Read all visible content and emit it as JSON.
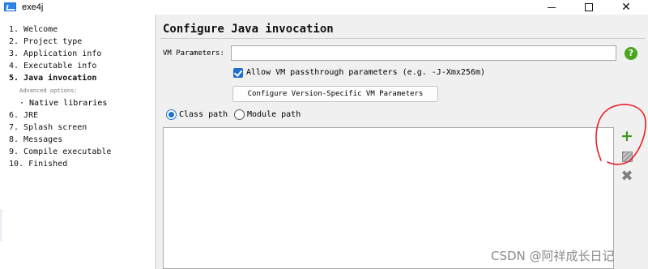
{
  "window": {
    "title": "exe4j"
  },
  "nav": {
    "items": [
      "1. Welcome",
      "2. Project type",
      "3. Application info",
      "4. Executable info",
      "5. Java invocation",
      "6. JRE",
      "7. Splash screen",
      "8. Messages",
      "9. Compile executable",
      "10. Finished"
    ],
    "advanced_caption": "Advanced options:",
    "advanced_items": [
      "· Native libraries"
    ]
  },
  "main": {
    "title": "Configure Java invocation",
    "vm_parameters_label": "VM Parameters:",
    "vm_parameters_value": "",
    "help_icon": "?",
    "allow_passthrough_label": "Allow VM passthrough parameters (e.g. -J-Xmx256m)",
    "allow_passthrough_checked": true,
    "configure_button": "Configure Version-Specific VM Parameters",
    "radio_class_path": "Class path",
    "radio_module_path": "Module path",
    "selected_path_mode": "Class path"
  },
  "side_buttons": {
    "add": "+",
    "remove": "✖"
  },
  "watermark": "CSDN @阿祥成长日记",
  "colors": {
    "accent": "#1f6fd0",
    "add_green": "#3a9a1c",
    "annotation_red": "#e8202a"
  }
}
